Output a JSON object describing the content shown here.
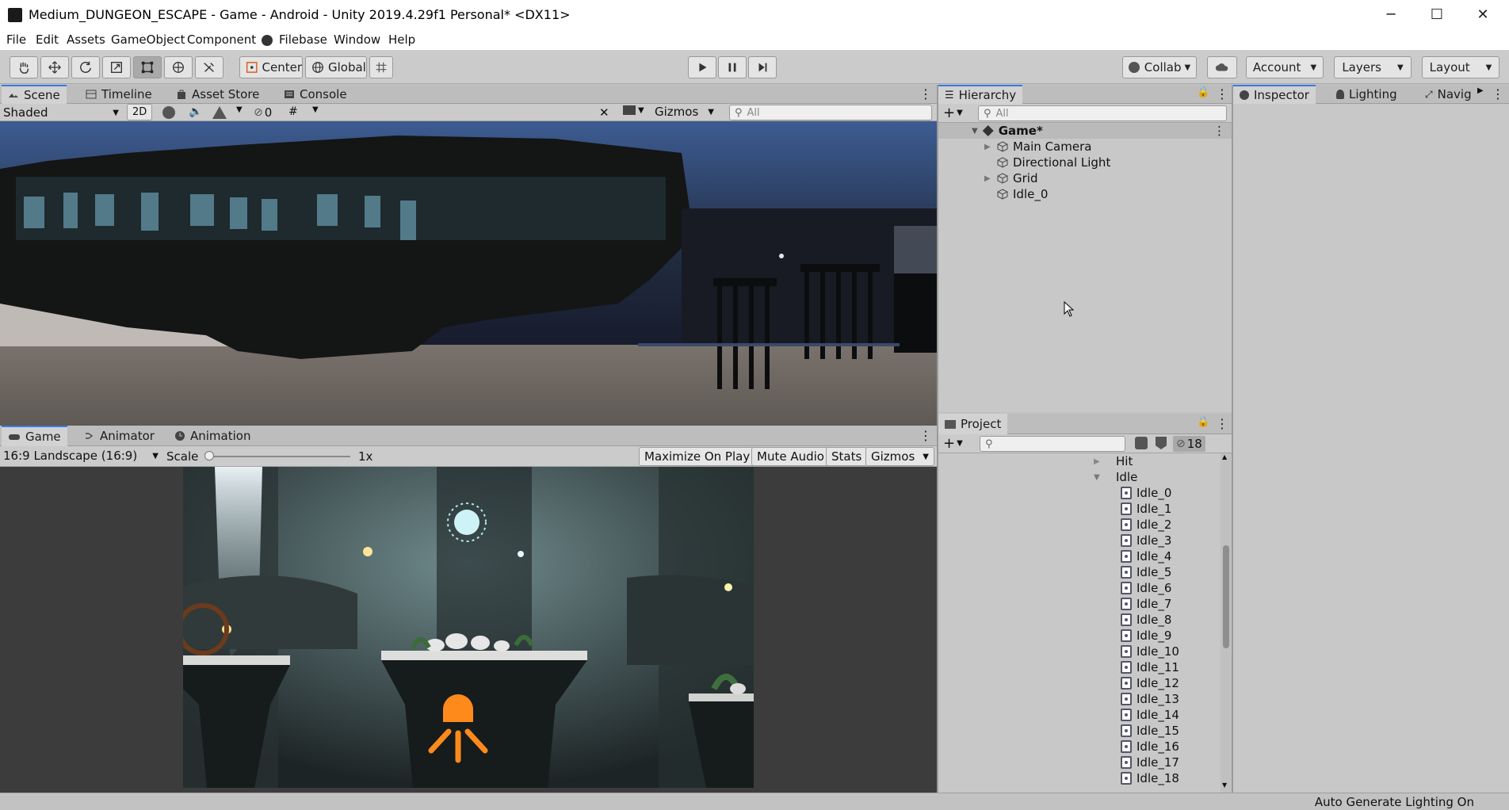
{
  "window": {
    "title": "Medium_DUNGEON_ESCAPE - Game - Android - Unity 2019.4.29f1 Personal* <DX11>",
    "controls": [
      "─",
      "☐",
      "✕"
    ]
  },
  "menu": [
    "File",
    "Edit",
    "Assets",
    "GameObject",
    "Component",
    "Filebase",
    "Window",
    "Help"
  ],
  "toolbar": {
    "pivot_label": "Center",
    "space_label": "Global",
    "collab_label": "Collab",
    "account_label": "Account",
    "layers_label": "Layers",
    "layout_label": "Layout"
  },
  "scene_panel": {
    "tabs": [
      "Scene",
      "Timeline",
      "Asset Store",
      "Console"
    ],
    "shading_mode": "Shaded",
    "mode_2d": "2D",
    "hidden_count": "0",
    "gizmos_label": "Gizmos",
    "search_placeholder": "All"
  },
  "game_panel": {
    "tabs": [
      "Game",
      "Animator",
      "Animation"
    ],
    "aspect": "16:9 Landscape (16:9)",
    "scale_label": "Scale",
    "scale_value": "1x",
    "maximize_on_play": "Maximize On Play",
    "mute_audio": "Mute Audio",
    "stats": "Stats",
    "gizmos_label": "Gizmos"
  },
  "hierarchy": {
    "tab": "Hierarchy",
    "search_placeholder": "All",
    "scene_name": "Game*",
    "items": [
      {
        "label": "Main Camera",
        "expandable": true
      },
      {
        "label": "Directional Light",
        "expandable": false
      },
      {
        "label": "Grid",
        "expandable": true
      },
      {
        "label": "Idle_0",
        "expandable": false
      }
    ]
  },
  "project": {
    "tab": "Project",
    "hidden_count": "18",
    "folders": [
      {
        "label": "Hit",
        "expanded": false
      },
      {
        "label": "Idle",
        "expanded": true
      }
    ],
    "files": [
      "Idle_0",
      "Idle_1",
      "Idle_2",
      "Idle_3",
      "Idle_4",
      "Idle_5",
      "Idle_6",
      "Idle_7",
      "Idle_8",
      "Idle_9",
      "Idle_10",
      "Idle_11",
      "Idle_12",
      "Idle_13",
      "Idle_14",
      "Idle_15",
      "Idle_16",
      "Idle_17",
      "Idle_18"
    ]
  },
  "inspector": {
    "tabs": [
      "Inspector",
      "Lighting",
      "Navig"
    ]
  },
  "status": {
    "text": "Auto Generate Lighting On"
  },
  "colors": {
    "accent": "#3b7be5",
    "light_icon": "#ff8a1c",
    "panel_bg": "#c2c2c2"
  }
}
